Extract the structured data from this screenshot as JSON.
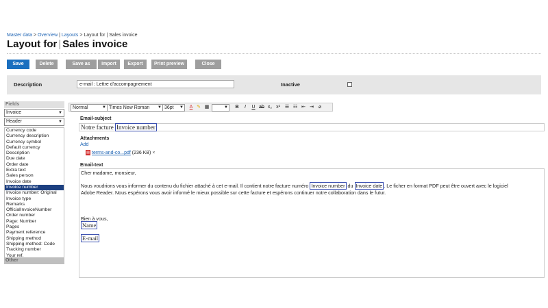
{
  "breadcrumb": {
    "items": [
      "Master data",
      "Overview",
      "Layouts"
    ],
    "current": "Layout for | Sales invoice"
  },
  "title": {
    "part1": "Layout for",
    "part2": "Sales invoice"
  },
  "toolbar": {
    "save": "Save",
    "delete": "Delete",
    "save_as": "Save as",
    "import": "Import",
    "export": "Export",
    "print_preview": "Print preview",
    "close": "Close"
  },
  "description": {
    "label": "Description",
    "value": "e-mail : Lettre d'accompagnement",
    "inactive_label": "Inactive"
  },
  "fields": {
    "heading": "Fields",
    "select1": "Invoice",
    "select2": "Header",
    "items": [
      "Currency code",
      "Currency description",
      "Currency symbol",
      "Default currency",
      "Description",
      "Due date",
      "Order date",
      "Extra text",
      "Sales person",
      "Invoice date",
      "Invoice number",
      "Invoice number: Original",
      "Invoice type",
      "Remarks",
      "OfficialInvoiceNumber",
      "Order number",
      "Page: Number",
      "Pages",
      "Payment reference",
      "Shipping method",
      "Shipping method: Code",
      "Tracking number",
      "Your ref."
    ],
    "selected_index": 10,
    "other_heading": "Other"
  },
  "editor_toolbar": {
    "style": "Normal",
    "font": "Times New Roman",
    "size": "36pt"
  },
  "email_subject": {
    "label": "Email-subject",
    "text": "Notre facture",
    "placeholder": "Invoice number"
  },
  "attachments": {
    "label": "Attachments",
    "add": "Add",
    "file_name": "terms-and-co...pdf",
    "file_size": "(236 KB)",
    "remove": "×"
  },
  "email_text": {
    "label": "Email-text",
    "greeting": "Cher madame, monsieur,",
    "p1_a": "Nous voudrions vous informer du contenu du fichier attaché à cet e-mail. Il contient notre facture numéro",
    "ph_invoice_number": "Invoice number",
    "p1_b": "du",
    "ph_invoice_date": "Invoice date",
    "p1_c": ". Le ficher en format PDF peut être ouvert avec le logiciel",
    "p1_line2": "Adobe Reader. Nous espérons vous avoir informé le mieux possible sur cette facture et espérons continuer notre collaboration dans le futur.",
    "closing": "Bien à vous,",
    "ph_name": "Name",
    "ph_email": "E-mail"
  }
}
